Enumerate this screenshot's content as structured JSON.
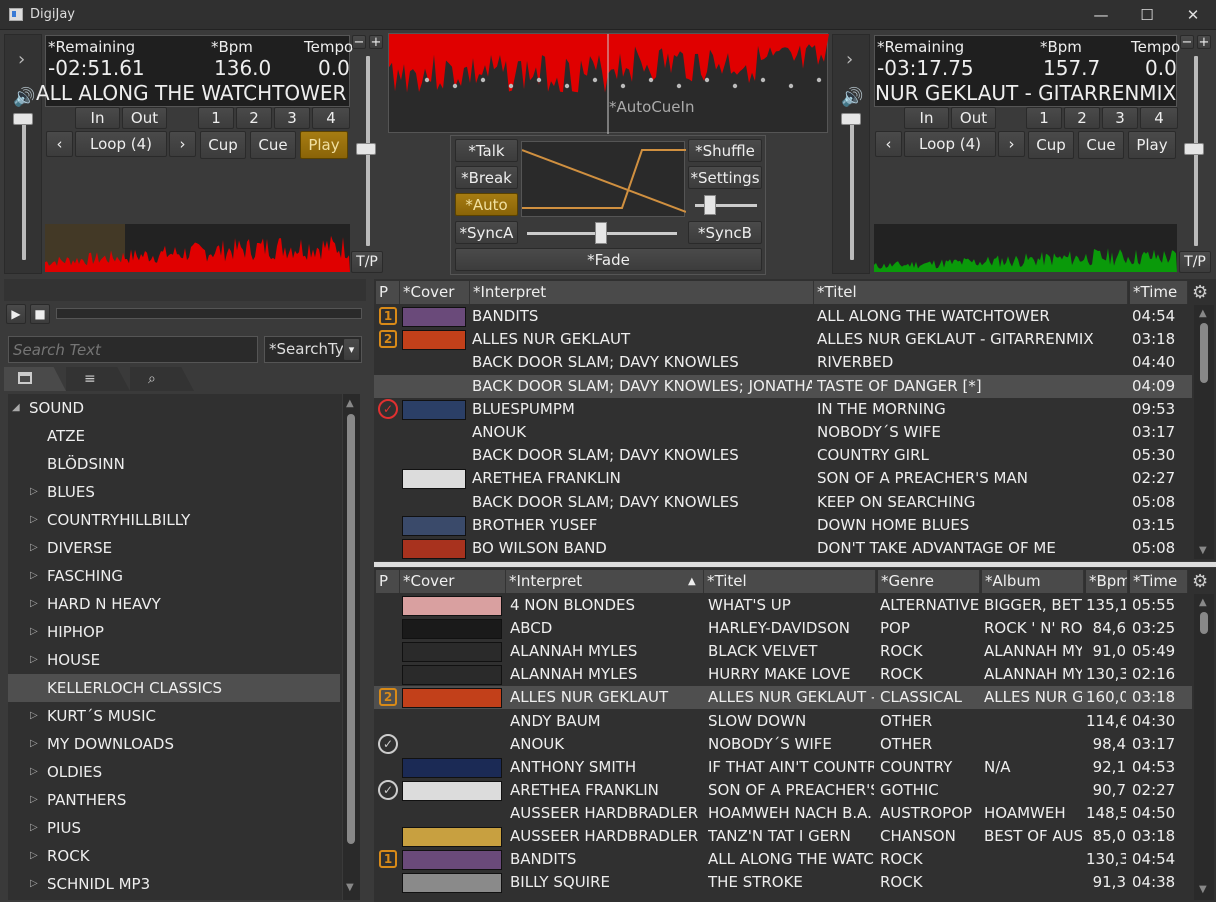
{
  "window": {
    "title": "DigiJay",
    "min": "—",
    "max": "☐",
    "close": "✕"
  },
  "deckA": {
    "remaining_label": "*Remaining",
    "bpm_label": "*Bpm",
    "tempo_label": "Tempo",
    "remaining": "-02:51.61",
    "bpm": "136.0",
    "tempo": "0.0",
    "track": "ALL ALONG THE WATCHTOWER",
    "in": "In",
    "out": "Out",
    "hot": [
      "1",
      "2",
      "3",
      "4"
    ],
    "loop": "Loop (4)",
    "cup": "Cup",
    "cue": "Cue",
    "play": "Play",
    "tp": "T/P",
    "minus": "−",
    "plus": "+",
    "prev": "‹",
    "next": "›",
    "expand": "›"
  },
  "deckB": {
    "remaining_label": "*Remaining",
    "bpm_label": "*Bpm",
    "tempo_label": "Tempo",
    "remaining": "-03:17.75",
    "bpm": "157.7",
    "tempo": "0.0",
    "track": "NUR GEKLAUT - GITARRENMIX",
    "in": "In",
    "out": "Out",
    "hot": [
      "1",
      "2",
      "3",
      "4"
    ],
    "loop": "Loop (4)",
    "cup": "Cup",
    "cue": "Cue",
    "play": "Play",
    "tp": "T/P",
    "minus": "−",
    "plus": "+",
    "prev": "‹",
    "next": "›",
    "expand": "›"
  },
  "center": {
    "autocue": "*AutoCueIn",
    "talk": "*Talk",
    "break": "*Break",
    "auto": "*Auto",
    "synca": "*SyncA",
    "shuffle": "*Shuffle",
    "settings": "*Settings",
    "syncb": "*SyncB",
    "fade": "*Fade"
  },
  "browser": {
    "search_placeholder": "Search Text",
    "search_type": "*SearchTy",
    "tree": [
      {
        "label": "SOUND",
        "arrow": "◢",
        "indent": 0
      },
      {
        "label": "ATZE",
        "arrow": "",
        "indent": 1
      },
      {
        "label": "BLÖDSINN",
        "arrow": "",
        "indent": 1
      },
      {
        "label": "BLUES",
        "arrow": "▷",
        "indent": 1
      },
      {
        "label": "COUNTRYHILLBILLY",
        "arrow": "▷",
        "indent": 1
      },
      {
        "label": "DIVERSE",
        "arrow": "▷",
        "indent": 1
      },
      {
        "label": "FASCHING",
        "arrow": "▷",
        "indent": 1
      },
      {
        "label": "HARD N HEAVY",
        "arrow": "▷",
        "indent": 1
      },
      {
        "label": "HIPHOP",
        "arrow": "▷",
        "indent": 1
      },
      {
        "label": "HOUSE",
        "arrow": "▷",
        "indent": 1
      },
      {
        "label": "KELLERLOCH CLASSICS",
        "arrow": "",
        "indent": 1,
        "selected": true
      },
      {
        "label": "KURT´S MUSIC",
        "arrow": "▷",
        "indent": 1
      },
      {
        "label": "MY DOWNLOADS",
        "arrow": "▷",
        "indent": 1
      },
      {
        "label": "OLDIES",
        "arrow": "▷",
        "indent": 1
      },
      {
        "label": "PANTHERS",
        "arrow": "▷",
        "indent": 1
      },
      {
        "label": "PIUS",
        "arrow": "▷",
        "indent": 1
      },
      {
        "label": "ROCK",
        "arrow": "▷",
        "indent": 1
      },
      {
        "label": "SCHNIDL MP3",
        "arrow": "▷",
        "indent": 1
      }
    ]
  },
  "playlist": {
    "headers": {
      "p": "P",
      "cover": "*Cover",
      "interpret": "*Interpret",
      "titel": "*Titel",
      "time": "*Time"
    },
    "rows": [
      {
        "p": "1",
        "cover": "#6a4a7a",
        "interpret": "BANDITS",
        "titel": "ALL ALONG THE WATCHTOWER",
        "time": "04:54"
      },
      {
        "p": "2",
        "cover": "#c2401a",
        "interpret": "ALLES NUR GEKLAUT",
        "titel": "ALLES NUR GEKLAUT - GITARRENMIX",
        "time": "03:18"
      },
      {
        "p": "",
        "cover": "",
        "interpret": "BACK DOOR SLAM; DAVY KNOWLES",
        "titel": "RIVERBED",
        "time": "04:40"
      },
      {
        "p": "",
        "cover": "",
        "interpret": "BACK DOOR SLAM; DAVY KNOWLES; JONATHA BRO",
        "titel": "TASTE OF DANGER [*]",
        "time": "04:09",
        "selected": true
      },
      {
        "p": "check-red",
        "cover": "#2b3f66",
        "interpret": "BLUESPUMPM",
        "titel": "IN THE MORNING",
        "time": "09:53"
      },
      {
        "p": "",
        "cover": "",
        "interpret": "ANOUK",
        "titel": "NOBODY´S WIFE",
        "time": "03:17"
      },
      {
        "p": "",
        "cover": "",
        "interpret": "BACK DOOR SLAM; DAVY KNOWLES",
        "titel": "COUNTRY GIRL",
        "time": "05:30"
      },
      {
        "p": "",
        "cover": "#dcdcdc",
        "interpret": "ARETHEA FRANKLIN",
        "titel": "SON OF A PREACHER'S MAN",
        "time": "02:27"
      },
      {
        "p": "",
        "cover": "",
        "interpret": "BACK DOOR SLAM; DAVY KNOWLES",
        "titel": "KEEP ON SEARCHING",
        "time": "05:08"
      },
      {
        "p": "",
        "cover": "#3a4a6a",
        "interpret": "BROTHER YUSEF",
        "titel": "DOWN HOME BLUES",
        "time": "03:15"
      },
      {
        "p": "",
        "cover": "#a8321e",
        "interpret": "BO WILSON BAND",
        "titel": "DON'T TAKE ADVANTAGE OF ME",
        "time": "05:08"
      }
    ]
  },
  "library": {
    "headers": {
      "p": "P",
      "cover": "*Cover",
      "interpret": "*Interpret",
      "titel": "*Titel",
      "genre": "*Genre",
      "album": "*Album",
      "bpm": "*Bpm",
      "time": "*Time",
      "sort": "▲"
    },
    "rows": [
      {
        "p": "",
        "cover": "#d9a0a0",
        "interpret": "4 NON BLONDES",
        "titel": "WHAT'S UP",
        "genre": "ALTERNATIVE",
        "album": "BIGGER, BETTI",
        "bpm": "135,1",
        "time": "05:55"
      },
      {
        "p": "",
        "cover": "#1a1a1a",
        "interpret": "ABCD",
        "titel": "HARLEY-DAVIDSON",
        "genre": "POP",
        "album": "ROCK ' N' ROLI",
        "bpm": "84,6",
        "time": "03:25"
      },
      {
        "p": "",
        "cover": "#2a2a2a",
        "interpret": "ALANNAH MYLES",
        "titel": "BLACK VELVET",
        "genre": "ROCK",
        "album": "ALANNAH MYLI",
        "bpm": "91,0",
        "time": "05:49"
      },
      {
        "p": "",
        "cover": "#2a2a2a",
        "interpret": "ALANNAH MYLES",
        "titel": "HURRY MAKE LOVE",
        "genre": "ROCK",
        "album": "ALANNAH MYLI",
        "bpm": "130,3",
        "time": "02:16"
      },
      {
        "p": "2",
        "cover": "#c2401a",
        "interpret": "ALLES NUR GEKLAUT",
        "titel": "ALLES NUR GEKLAUT - GI",
        "genre": "CLASSICAL",
        "album": "ALLES NUR GEI",
        "bpm": "160,0",
        "time": "03:18",
        "selected": true
      },
      {
        "p": "",
        "cover": "",
        "interpret": "ANDY BAUM",
        "titel": "SLOW DOWN",
        "genre": "OTHER",
        "album": "",
        "bpm": "114,6",
        "time": "04:30"
      },
      {
        "p": "check",
        "cover": "",
        "interpret": "ANOUK",
        "titel": "NOBODY´S WIFE",
        "genre": "OTHER",
        "album": "",
        "bpm": "98,4",
        "time": "03:17"
      },
      {
        "p": "",
        "cover": "#1b2a55",
        "interpret": "ANTHONY SMITH",
        "titel": "IF THAT AIN'T COUNTRY",
        "genre": "COUNTRY",
        "album": "N/A",
        "bpm": "92,1",
        "time": "04:53"
      },
      {
        "p": "check",
        "cover": "#dcdcdc",
        "interpret": "ARETHEA FRANKLIN",
        "titel": "SON OF A PREACHER'S M",
        "genre": "GOTHIC",
        "album": "",
        "bpm": "90,7",
        "time": "02:27"
      },
      {
        "p": "",
        "cover": "",
        "interpret": "AUSSEER HARDBRADLER",
        "titel": "HOAMWEH NACH B.A.",
        "genre": "AUSTROPOP",
        "album": "HOAMWEH",
        "bpm": "148,5",
        "time": "04:50"
      },
      {
        "p": "",
        "cover": "#c8a040",
        "interpret": "AUSSEER HARDBRADLER",
        "titel": "TANZ'N TAT I GERN",
        "genre": "CHANSON",
        "album": "BEST OF AUSTI",
        "bpm": "85,0",
        "time": "03:18"
      },
      {
        "p": "1",
        "cover": "#6a4a7a",
        "interpret": "BANDITS",
        "titel": "ALL ALONG THE WATCHT",
        "genre": "ROCK",
        "album": "",
        "bpm": "130,3",
        "time": "04:54"
      },
      {
        "p": "",
        "cover": "#8a8a8a",
        "interpret": "BILLY SQUIRE",
        "titel": "THE STROKE",
        "genre": "ROCK",
        "album": "",
        "bpm": "91,3",
        "time": "04:38"
      }
    ]
  },
  "colors": {
    "accent": "#a67c12",
    "waveA": "#e00000",
    "waveB": "#0a9a0a",
    "badge": "#d88a18",
    "checkRed": "#e03030"
  }
}
